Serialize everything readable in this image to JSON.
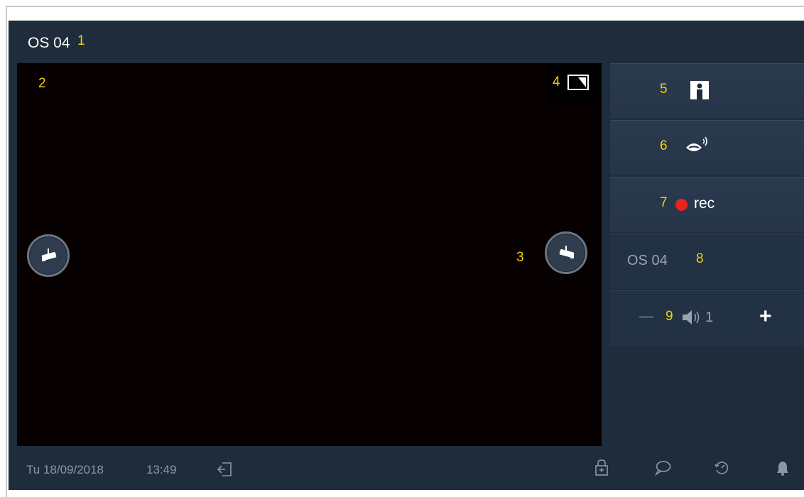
{
  "header": {
    "title": "OS 04",
    "callout": "1"
  },
  "video": {
    "callout_main": "2",
    "callout_right_cam": "3",
    "callout_fullscreen": "4",
    "left_cam_icon": "camera-icon",
    "right_cam_icon": "camera-icon",
    "fullscreen_icon": "fullscreen-icon"
  },
  "side": {
    "door_callout": "5",
    "door_icon": "door-icon",
    "talk_callout": "6",
    "talk_icon": "talk-icon",
    "rec_callout": "7",
    "rec_label": "rec",
    "rec_color": "#e8231c",
    "station_label": "OS 04",
    "station_callout": "8",
    "volume_callout": "9",
    "volume_value": "1",
    "volume_minus": "−",
    "volume_plus": "+"
  },
  "status": {
    "date": "Tu 18/09/2018",
    "time": "13:49",
    "icons": [
      "exit-icon",
      "lock-icon",
      "chat-icon",
      "history-icon",
      "bell-icon"
    ]
  },
  "colors": {
    "background": "#1e2c3c",
    "callout": "#f4d100",
    "video": "#060000"
  }
}
